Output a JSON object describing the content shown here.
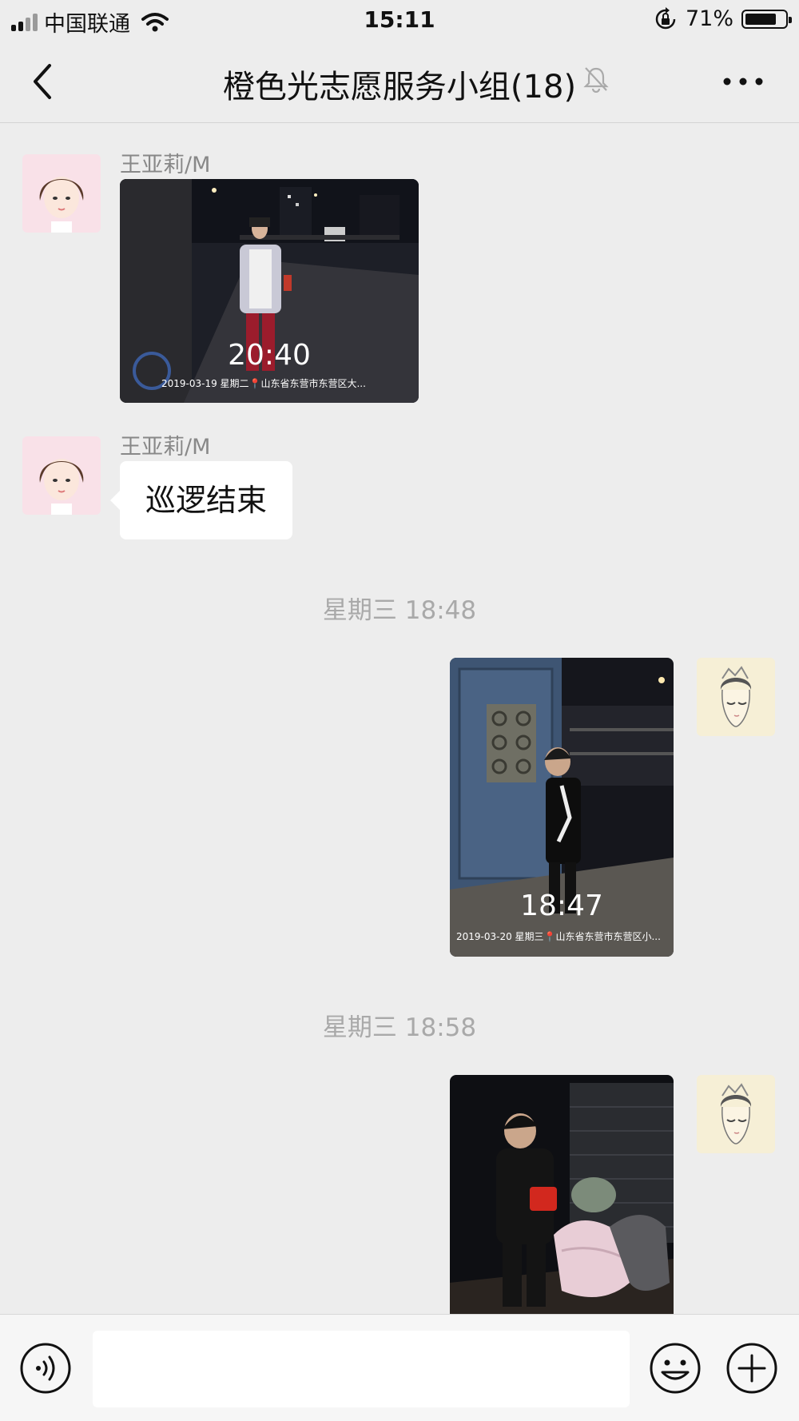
{
  "status_bar": {
    "carrier": "中国联通",
    "time": "15:11",
    "battery_text": "71%",
    "battery_level": 0.71
  },
  "nav": {
    "title": "橙色光志愿服务小组(18)"
  },
  "messages": [
    {
      "sender": "王亚莉/M",
      "photo_time": "20:40",
      "photo_caption": "2019-03-19  星期二📍山东省东营市东营区大..."
    },
    {
      "sender": "王亚莉/M",
      "text": "巡逻结束"
    },
    {
      "timestamp": "星期三 18:48",
      "photo_time": "18:47",
      "photo_caption": "2019-03-20  星期三📍山东省东营市东营区小..."
    },
    {
      "timestamp": "星期三 18:58"
    }
  ],
  "input": {
    "placeholder": ""
  }
}
